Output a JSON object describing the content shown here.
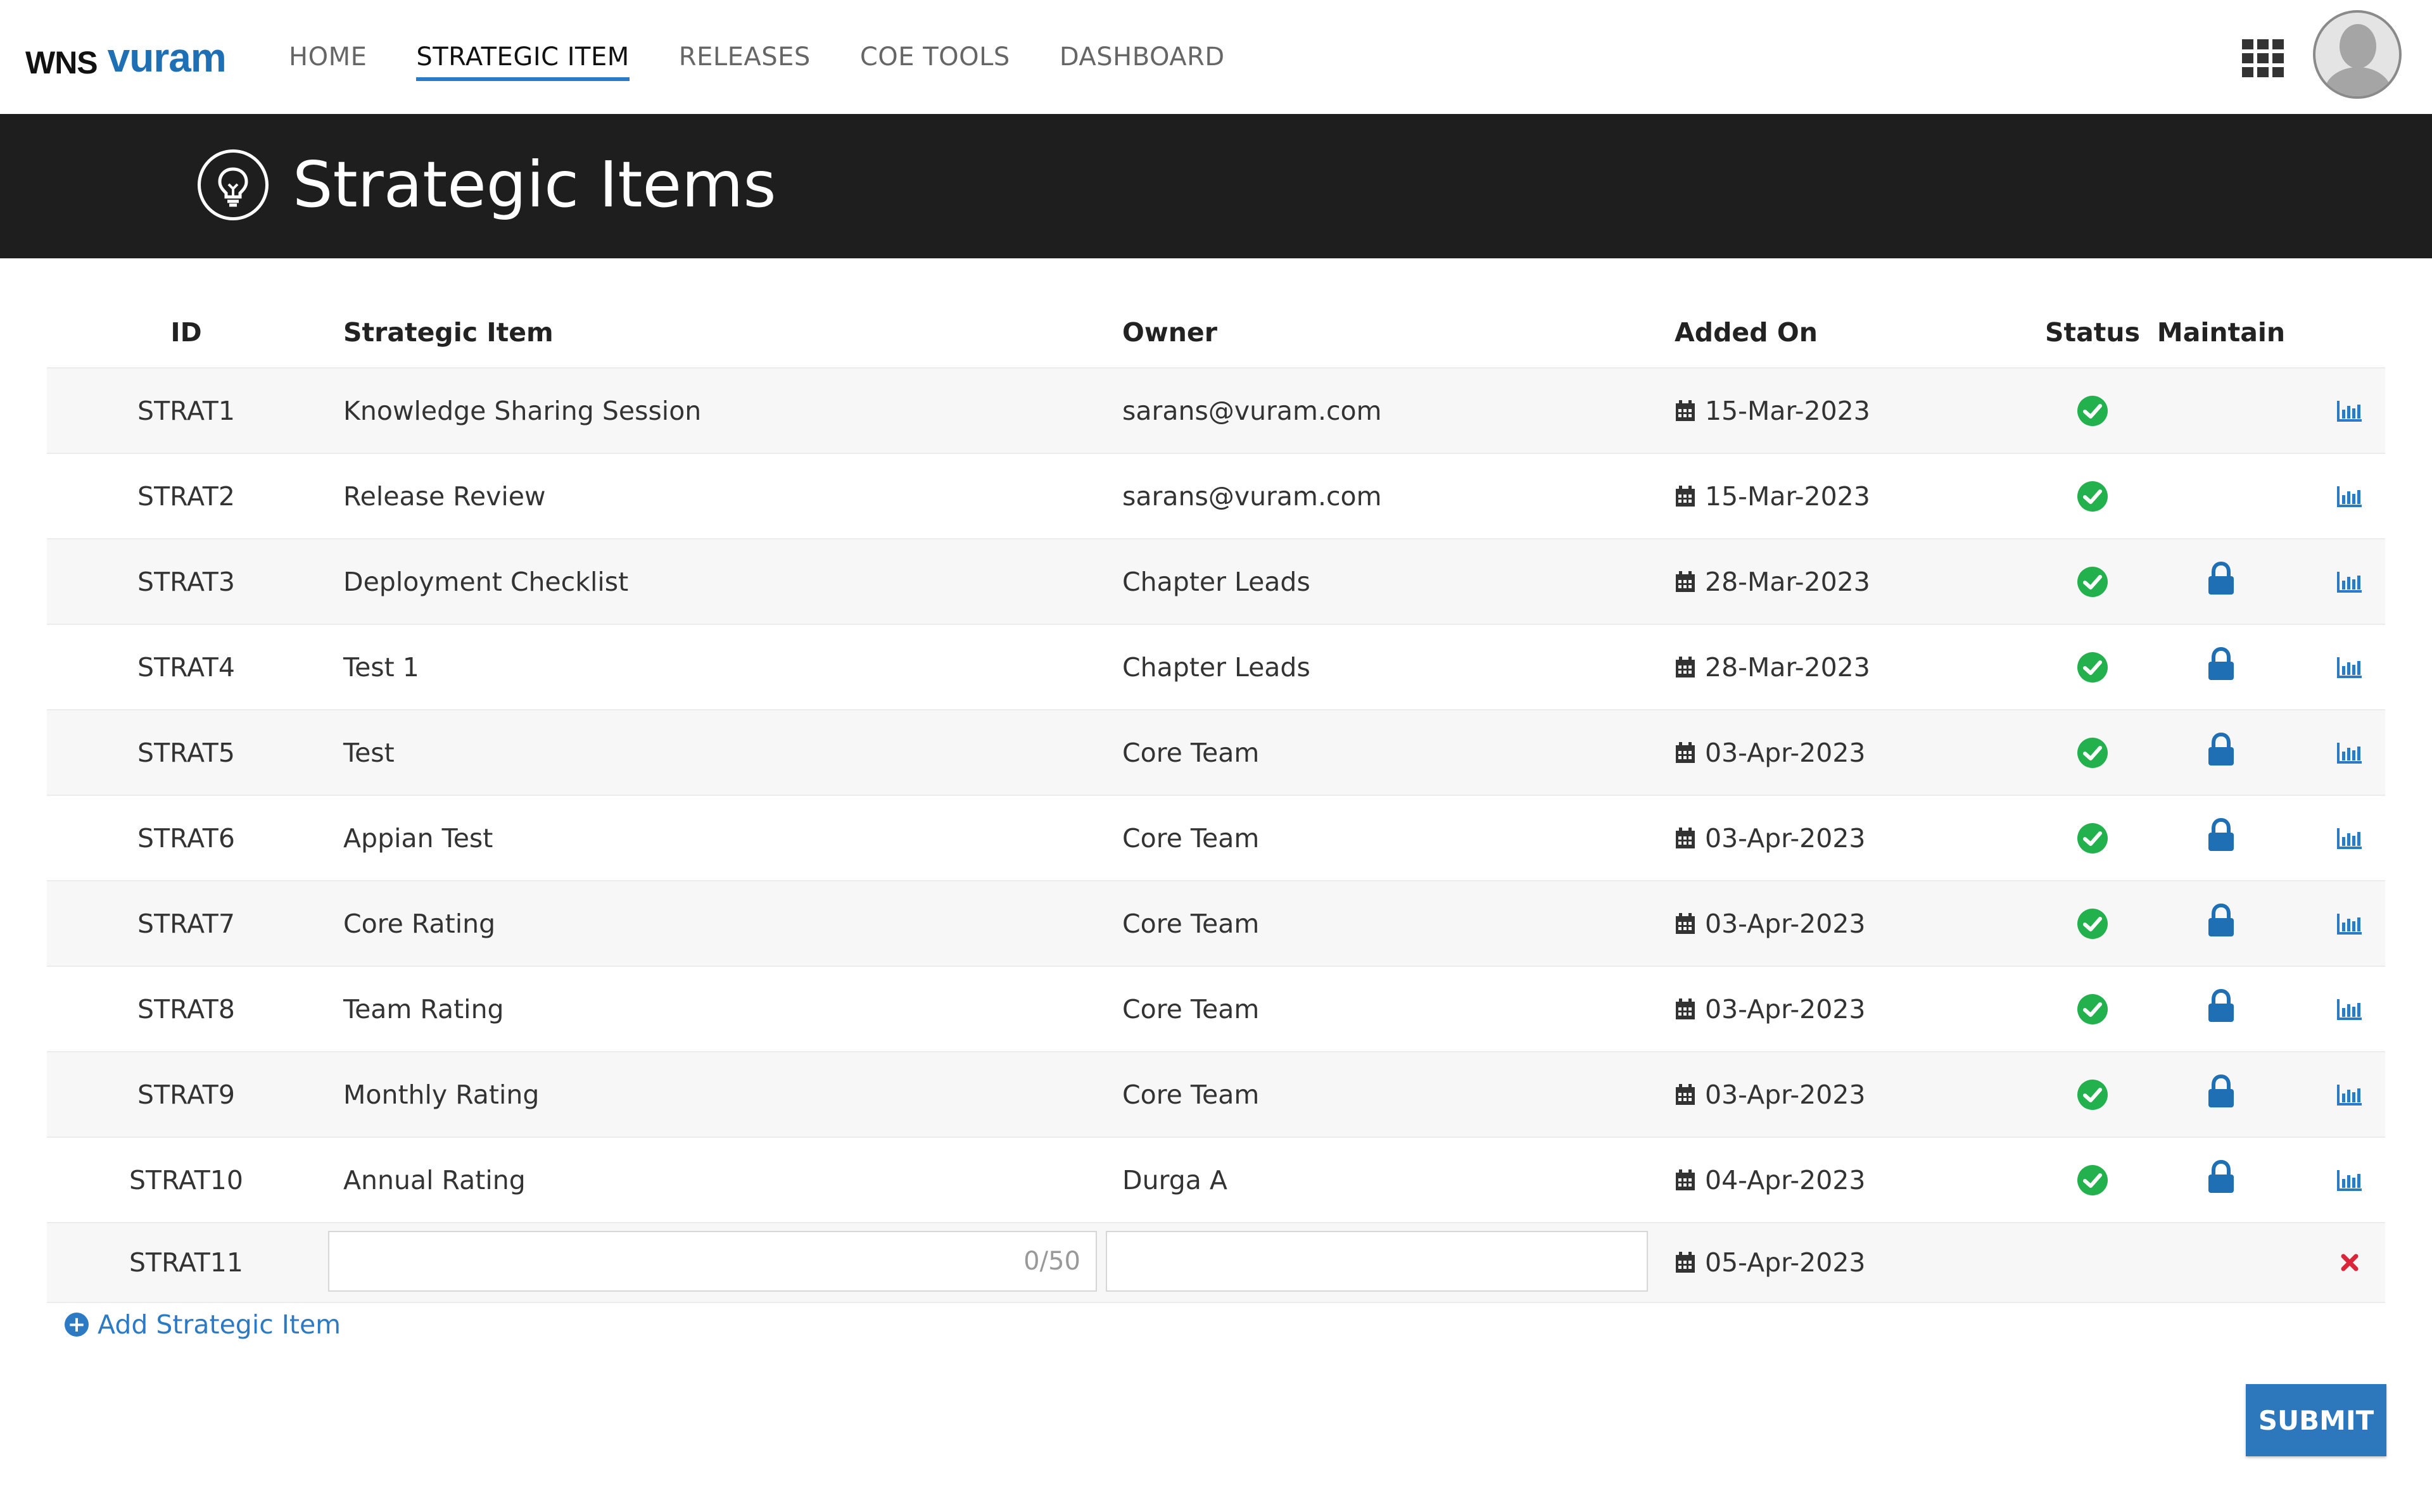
{
  "brand": {
    "wns": "WNS",
    "vuram": "vuram"
  },
  "nav": {
    "items": [
      {
        "label": "HOME",
        "active": false
      },
      {
        "label": "STRATEGIC ITEM",
        "active": true
      },
      {
        "label": "RELEASES",
        "active": false
      },
      {
        "label": "COE TOOLS",
        "active": false
      },
      {
        "label": "DASHBOARD",
        "active": false
      }
    ]
  },
  "banner": {
    "title": "Strategic Items",
    "icon": "lightbulb-icon"
  },
  "table": {
    "headers": {
      "id": "ID",
      "item": "Strategic Item",
      "owner": "Owner",
      "added_on": "Added On",
      "status": "Status",
      "maintain": "Maintain"
    },
    "rows": [
      {
        "id": "STRAT1",
        "item": "Knowledge Sharing Session",
        "owner": "sarans@vuram.com",
        "date": "15-Mar-2023",
        "status": "check",
        "locked": false
      },
      {
        "id": "STRAT2",
        "item": "Release Review",
        "owner": "sarans@vuram.com",
        "date": "15-Mar-2023",
        "status": "check",
        "locked": false
      },
      {
        "id": "STRAT3",
        "item": "Deployment Checklist",
        "owner": "Chapter Leads",
        "date": "28-Mar-2023",
        "status": "check",
        "locked": true
      },
      {
        "id": "STRAT4",
        "item": "Test  1",
        "owner": "Chapter Leads",
        "date": "28-Mar-2023",
        "status": "check",
        "locked": true
      },
      {
        "id": "STRAT5",
        "item": "Test",
        "owner": "Core Team",
        "date": "03-Apr-2023",
        "status": "check",
        "locked": true
      },
      {
        "id": "STRAT6",
        "item": "Appian Test",
        "owner": "Core Team",
        "date": "03-Apr-2023",
        "status": "check",
        "locked": true
      },
      {
        "id": "STRAT7",
        "item": "Core Rating",
        "owner": "Core Team",
        "date": "03-Apr-2023",
        "status": "check",
        "locked": true
      },
      {
        "id": "STRAT8",
        "item": "Team Rating",
        "owner": "Core Team",
        "date": "03-Apr-2023",
        "status": "check",
        "locked": true
      },
      {
        "id": "STRAT9",
        "item": "Monthly Rating",
        "owner": "Core Team",
        "date": "03-Apr-2023",
        "status": "check",
        "locked": true
      },
      {
        "id": "STRAT10",
        "item": "Annual Rating",
        "owner": "Durga A",
        "date": "04-Apr-2023",
        "status": "check",
        "locked": true
      }
    ],
    "new_row": {
      "id": "STRAT11",
      "item_value": "",
      "item_count": "0/50",
      "owner_value": "",
      "date": "05-Apr-2023"
    }
  },
  "actions": {
    "add_label": "Add Strategic Item",
    "submit_label": "SUBMIT"
  },
  "colors": {
    "accent": "#2c7ac4",
    "success": "#22b14c",
    "danger": "#d9263b",
    "banner": "#1e1e1e"
  }
}
